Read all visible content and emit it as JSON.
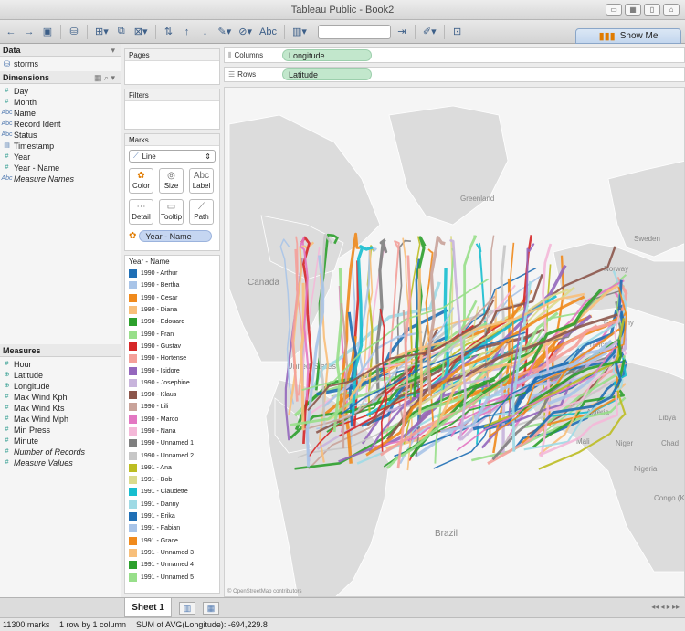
{
  "window": {
    "title": "Tableau Public - Book2"
  },
  "toolbar": {
    "show_me_label": "Show Me",
    "abc_label": "Abc"
  },
  "data_pane": {
    "heading": "Data",
    "datasource": "storms",
    "dimensions_heading": "Dimensions",
    "dimensions": [
      {
        "icon": "#",
        "label": "Day",
        "italic": false
      },
      {
        "icon": "#",
        "label": "Month",
        "italic": false
      },
      {
        "icon": "Abc",
        "label": "Name",
        "italic": false
      },
      {
        "icon": "Abc",
        "label": "Record Ident",
        "italic": false
      },
      {
        "icon": "Abc",
        "label": "Status",
        "italic": false
      },
      {
        "icon": "cal",
        "label": "Timestamp",
        "italic": false
      },
      {
        "icon": "#",
        "label": "Year",
        "italic": false
      },
      {
        "icon": "#",
        "label": "Year - Name",
        "italic": false
      },
      {
        "icon": "Abc",
        "label": "Measure Names",
        "italic": true
      }
    ],
    "measures_heading": "Measures",
    "measures": [
      {
        "icon": "#",
        "label": "Hour",
        "italic": false
      },
      {
        "icon": "globe",
        "label": "Latitude",
        "italic": false
      },
      {
        "icon": "globe",
        "label": "Longitude",
        "italic": false
      },
      {
        "icon": "#",
        "label": "Max Wind Kph",
        "italic": false
      },
      {
        "icon": "#",
        "label": "Max Wind Kts",
        "italic": false
      },
      {
        "icon": "#",
        "label": "Max Wind Mph",
        "italic": false
      },
      {
        "icon": "#",
        "label": "Min Press",
        "italic": false
      },
      {
        "icon": "#",
        "label": "Minute",
        "italic": false
      },
      {
        "icon": "#",
        "label": "Number of Records",
        "italic": true
      },
      {
        "icon": "#",
        "label": "Measure Values",
        "italic": true
      }
    ]
  },
  "cards": {
    "pages": "Pages",
    "filters": "Filters",
    "marks": "Marks",
    "mark_type": "Line",
    "mark_buttons": [
      "Color",
      "Size",
      "Label",
      "Detail",
      "Tooltip",
      "Path"
    ],
    "color_pill": "Year - Name"
  },
  "shelves": {
    "columns_label": "Columns",
    "columns_pill": "Longitude",
    "rows_label": "Rows",
    "rows_pill": "Latitude"
  },
  "legend": {
    "title": "Year - Name",
    "items": [
      {
        "label": "1990 - Arthur",
        "color": "#1f6fb5"
      },
      {
        "label": "1990 - Bertha",
        "color": "#a8c4e8"
      },
      {
        "label": "1990 - Cesar",
        "color": "#f08a1c"
      },
      {
        "label": "1990 - Diana",
        "color": "#f8bf7a"
      },
      {
        "label": "1990 - Edouard",
        "color": "#2ca02c"
      },
      {
        "label": "1990 - Fran",
        "color": "#98df8a"
      },
      {
        "label": "1990 - Gustav",
        "color": "#d62728"
      },
      {
        "label": "1990 - Hortense",
        "color": "#f4a09a"
      },
      {
        "label": "1990 - Isidore",
        "color": "#9467bd"
      },
      {
        "label": "1990 - Josephine",
        "color": "#c8b4dc"
      },
      {
        "label": "1990 - Klaus",
        "color": "#8c564b"
      },
      {
        "label": "1990 - Lili",
        "color": "#c9a39a"
      },
      {
        "label": "1990 - Marco",
        "color": "#e377c2"
      },
      {
        "label": "1990 - Nana",
        "color": "#f4b8d8"
      },
      {
        "label": "1990 - Unnamed 1",
        "color": "#7f7f7f"
      },
      {
        "label": "1990 - Unnamed 2",
        "color": "#c7c7c7"
      },
      {
        "label": "1991 - Ana",
        "color": "#bcbd22"
      },
      {
        "label": "1991 - Bob",
        "color": "#dbdb8d"
      },
      {
        "label": "1991 - Claudette",
        "color": "#17becf"
      },
      {
        "label": "1991 - Danny",
        "color": "#9edae5"
      },
      {
        "label": "1991 - Erika",
        "color": "#1f6fb5"
      },
      {
        "label": "1991 - Fabian",
        "color": "#a8c4e8"
      },
      {
        "label": "1991 - Grace",
        "color": "#f08a1c"
      },
      {
        "label": "1991 - Unnamed 3",
        "color": "#f8bf7a"
      },
      {
        "label": "1991 - Unnamed 4",
        "color": "#2ca02c"
      },
      {
        "label": "1991 - Unnamed 5",
        "color": "#98df8a"
      }
    ]
  },
  "map": {
    "labels": [
      "Greenland",
      "Sweden",
      "Norway",
      "Canada",
      "Germany",
      "France",
      "United States",
      "Algeria",
      "Libya",
      "Mali",
      "Niger",
      "Chad",
      "Nigeria",
      "Congo (Kinshasa)",
      "Brazil"
    ],
    "attribution": "© OpenStreetMap contributors"
  },
  "sheet_tab": "Sheet 1",
  "status": {
    "marks": "11300 marks",
    "rows_cols": "1 row by 1 column",
    "sum": "SUM of AVG(Longitude): -694,229.8"
  }
}
